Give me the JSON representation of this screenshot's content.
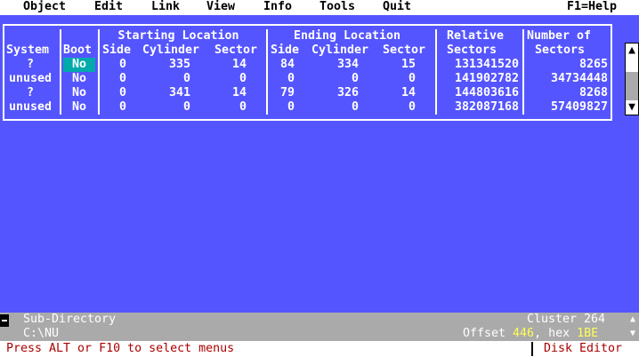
{
  "menu": {
    "items": [
      "Object",
      "Edit",
      "Link",
      "View",
      "Info",
      "Tools",
      "Quit"
    ],
    "help": "F1=Help"
  },
  "table": {
    "headers": {
      "system": "System",
      "boot": "Boot",
      "starting": "Starting Location",
      "ending": "Ending Location",
      "side": "Side",
      "cylinder": "Cylinder",
      "sector": "Sector",
      "relative1": "Relative",
      "relative2": "Sectors",
      "number1": "Number of",
      "number2": "Sectors"
    },
    "rows": [
      [
        "?",
        "No",
        "0",
        "335",
        "14",
        "84",
        "334",
        "15",
        "131341520",
        "8265"
      ],
      [
        "unused",
        "No",
        "0",
        "0",
        "0",
        "0",
        "0",
        "0",
        "141902782",
        "34734448"
      ],
      [
        "?",
        "No",
        "0",
        "341",
        "14",
        "79",
        "326",
        "14",
        "144803616",
        "8268"
      ],
      [
        "unused",
        "No",
        "0",
        "0",
        "0",
        "0",
        "0",
        "0",
        "382087168",
        "57409827"
      ]
    ]
  },
  "status": {
    "object_type": "Sub-Directory",
    "path": "C:\\NU",
    "cluster_label": "Cluster 264",
    "offset_label": "Offset ",
    "offset_dec": "446",
    "hex_label": ", hex ",
    "offset_hex": "1BE"
  },
  "hint": {
    "text": "Press ALT or F10 to select menus",
    "app": "Disk Editor"
  },
  "colors": {
    "background": "#5555ff",
    "highlight": "#00aaaa",
    "status": "#aaaaaa",
    "hint": "#aa0000"
  }
}
